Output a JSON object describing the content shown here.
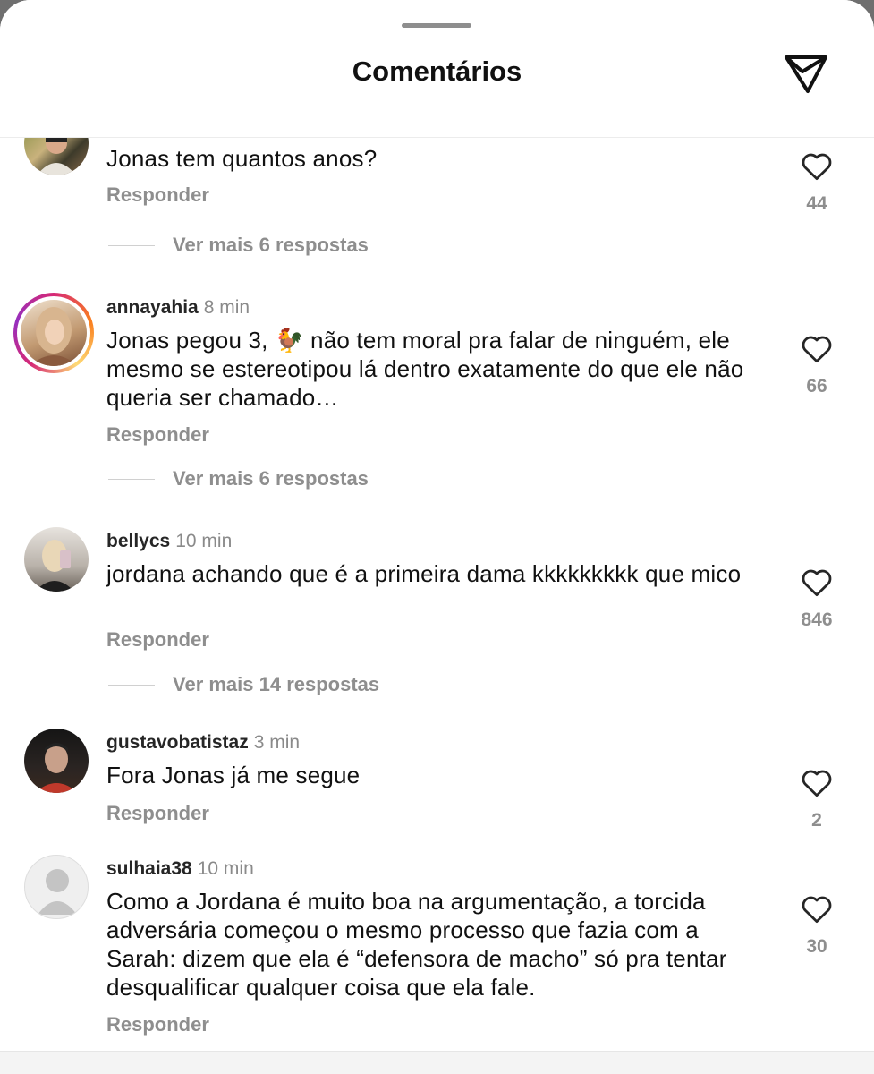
{
  "header": {
    "title": "Comentários"
  },
  "comments": [
    {
      "user": "",
      "time": "",
      "text": "Jonas tem quantos anos?",
      "reply": "Responder",
      "likes": "44",
      "more": "Ver mais 6 respostas"
    },
    {
      "user": "annayahia",
      "time": "8 min",
      "text": "Jonas pegou 3, 🐓 não tem moral pra falar de ninguém, ele mesmo se estereotipou lá dentro exatamente do que ele não queria ser chamado…",
      "reply": "Responder",
      "likes": "66",
      "more": "Ver mais 6 respostas"
    },
    {
      "user": "bellycs",
      "time": "10 min",
      "text": "jordana achando que é a primeira dama kkkkkkkkk que mico",
      "reply": "Responder",
      "likes": "846",
      "more": "Ver mais 14 respostas"
    },
    {
      "user": "gustavobatistaz",
      "time": "3 min",
      "text": "Fora Jonas já me segue",
      "reply": "Responder",
      "likes": "2"
    },
    {
      "user": "sulhaia38",
      "time": "10 min",
      "text": "Como a Jordana é muito boa na argumentação, a torcida adversária começou o mesmo processo que fazia com a Sarah: dizem que ela é “defensora de macho” só pra tentar desqualificar qualquer coisa que ela fale.",
      "reply": "Responder",
      "likes": "30"
    }
  ],
  "colors": {
    "text": "#111111",
    "secondary": "#8e8e8e",
    "story_ring": "#d62976"
  },
  "icons": {
    "share": "send-icon",
    "like": "heart-outline-icon",
    "default_avatar": "person-silhouette-icon"
  }
}
